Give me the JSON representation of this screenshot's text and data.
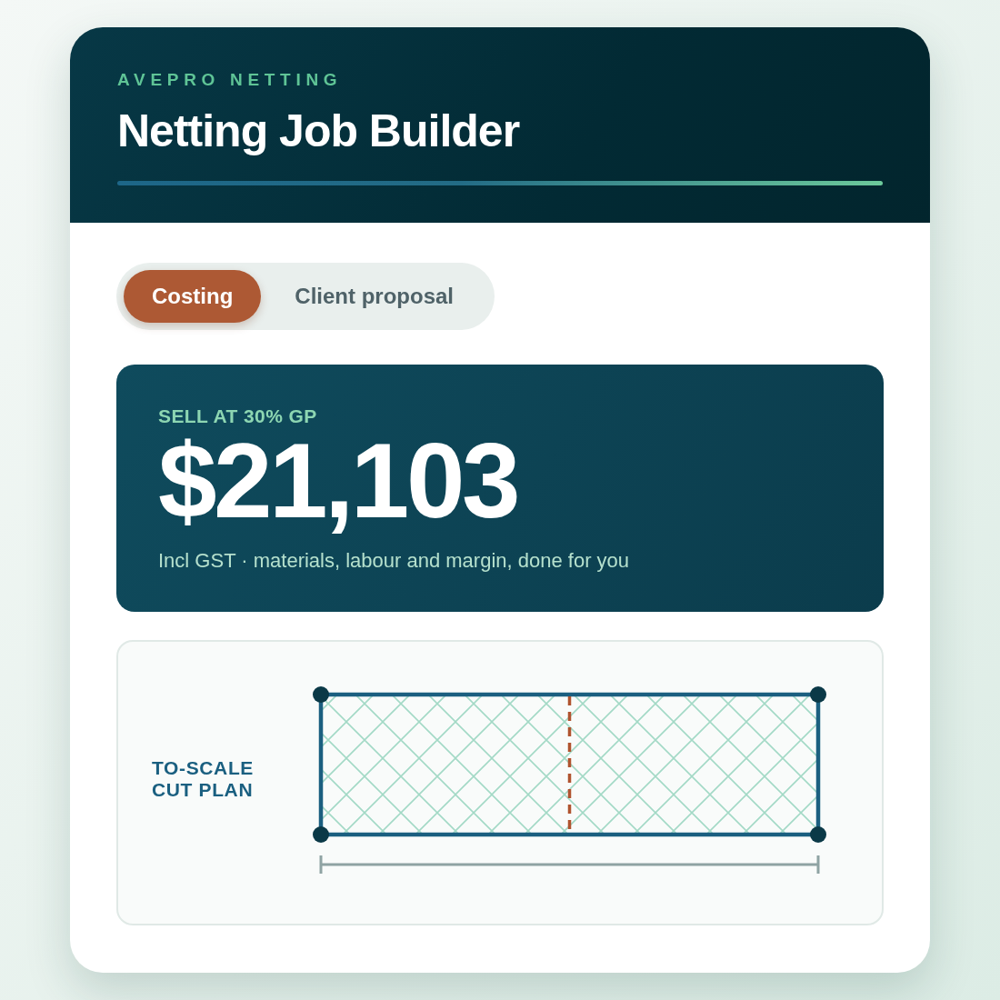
{
  "header": {
    "eyebrow": "AVEPRO NETTING",
    "title": "Netting Job Builder"
  },
  "tabs": [
    {
      "label": "Costing",
      "selected": true
    },
    {
      "label": "Client proposal",
      "selected": false
    }
  ],
  "price_card": {
    "label": "SELL AT 30% GP",
    "amount": "$21,103",
    "note": "Incl GST · materials, labour and margin, done for you"
  },
  "cut_plan": {
    "label": "TO-SCALE CUT PLAN"
  }
}
